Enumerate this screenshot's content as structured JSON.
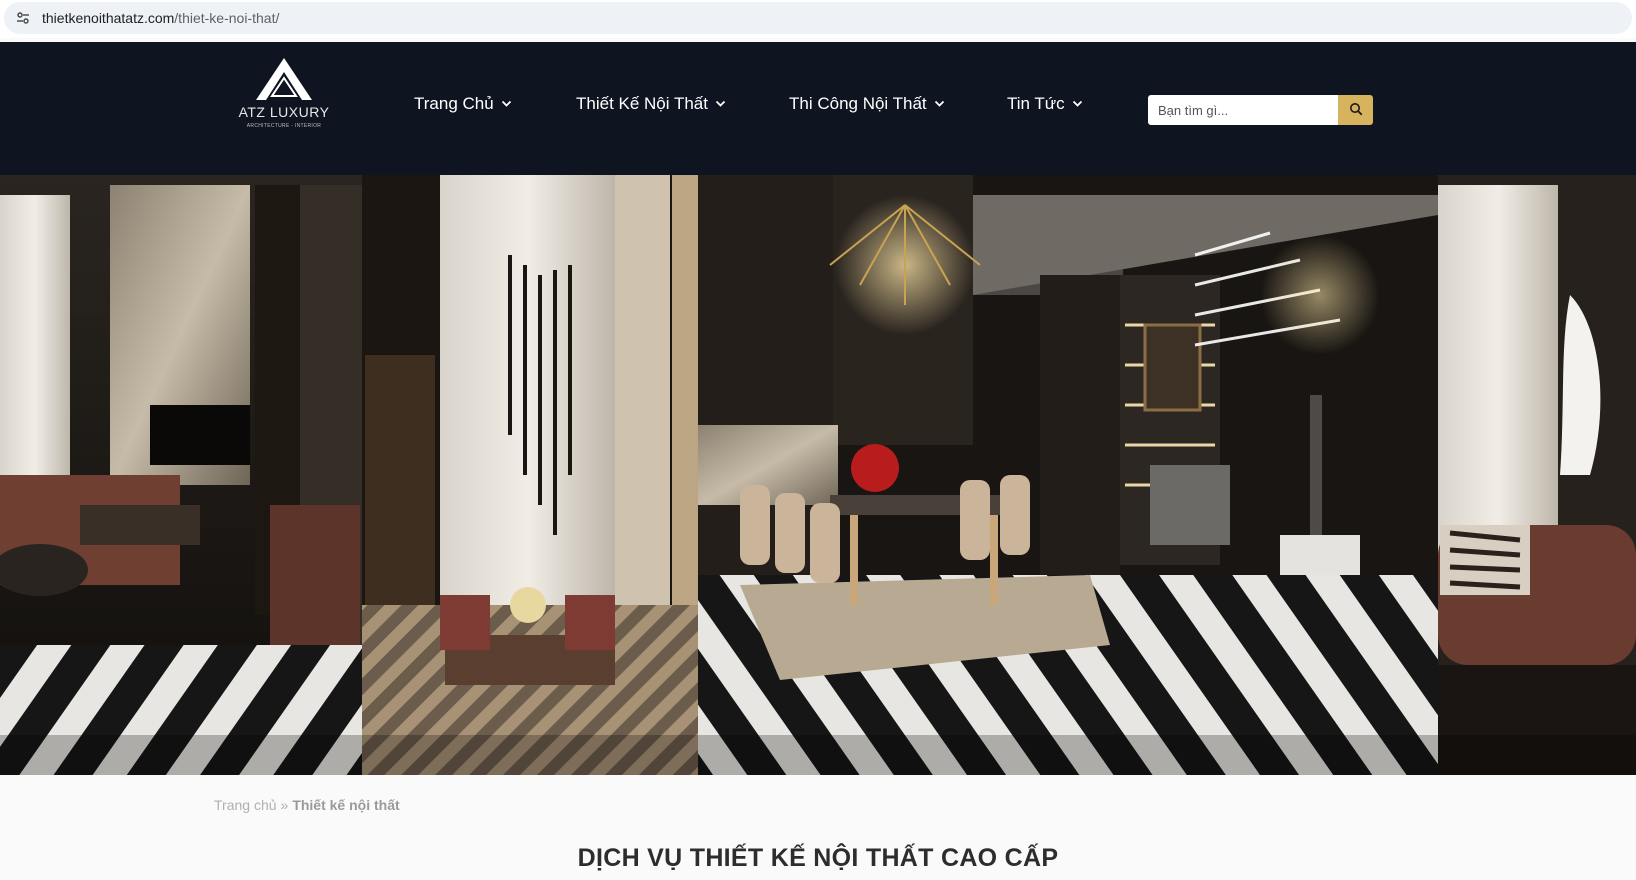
{
  "browser": {
    "url_domain": "thietkenoithatatz.com",
    "url_path": "/thiet-ke-noi-that/"
  },
  "header": {
    "logo_text": "ATZ LUXURY",
    "logo_subtext": "ARCHITECTURE - INTERIOR",
    "nav": [
      {
        "label": "Trang Chủ"
      },
      {
        "label": "Thiết Kế Nội Thất"
      },
      {
        "label": "Thi Công Nội Thất"
      },
      {
        "label": "Tin Tức"
      }
    ],
    "search": {
      "placeholder": "Bạn tìm gì..."
    }
  },
  "breadcrumb": {
    "home": "Trang chủ",
    "separator": "»",
    "current": "Thiết kế nội thất"
  },
  "page": {
    "title": "DỊCH VỤ THIẾT KẾ NỘI THẤT CAO CẤP"
  },
  "colors": {
    "header_bg": "#0e1520",
    "search_button": "#d6b35c",
    "accent_gold": "#c9a14a"
  }
}
